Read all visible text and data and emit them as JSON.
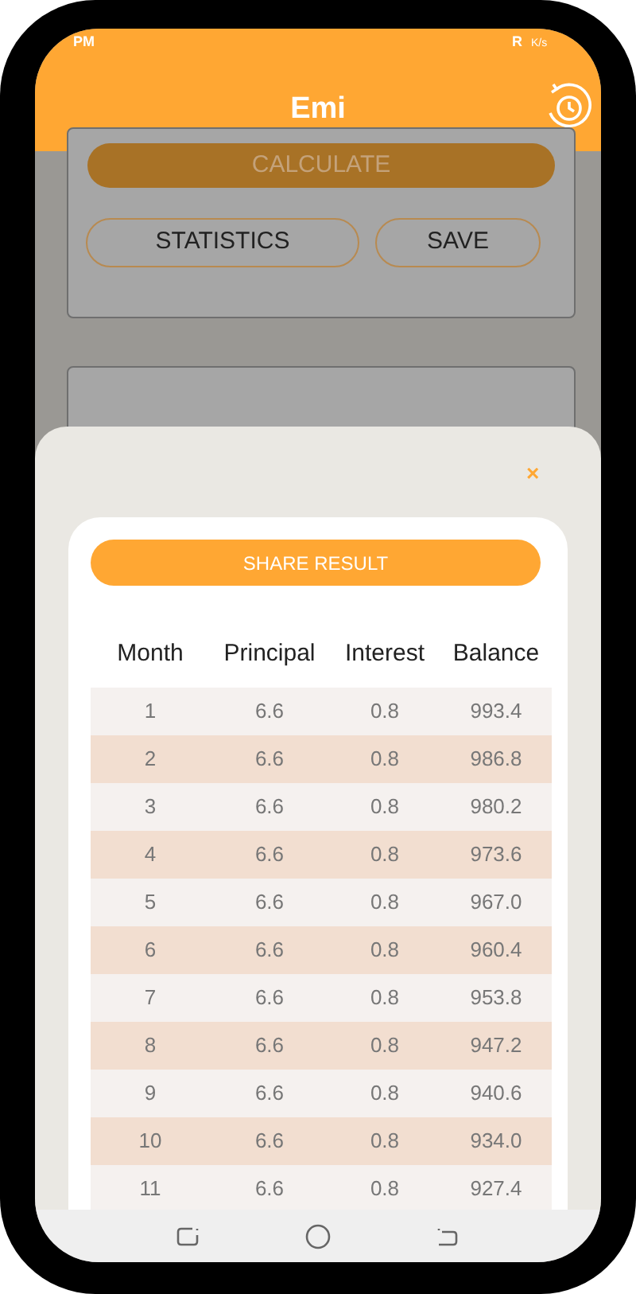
{
  "status_bar": {
    "time": "PM",
    "network": "R",
    "speed": "K/s"
  },
  "app_bar": {
    "title": "Emi"
  },
  "form": {
    "calculate": "CALCULATE",
    "buttons": [
      "STATISTICS",
      "SAVE"
    ]
  },
  "sheet": {
    "close": "×",
    "share": "SHARE RESULT",
    "table": {
      "columns": [
        "Month",
        "Principal",
        "Interest",
        "Balance"
      ],
      "rows": [
        [
          "1",
          "6.6",
          "0.8",
          "993.4"
        ],
        [
          "2",
          "6.6",
          "0.8",
          "986.8"
        ],
        [
          "3",
          "6.6",
          "0.8",
          "980.2"
        ],
        [
          "4",
          "6.6",
          "0.8",
          "973.6"
        ],
        [
          "5",
          "6.6",
          "0.8",
          "967.0"
        ],
        [
          "6",
          "6.6",
          "0.8",
          "960.4"
        ],
        [
          "7",
          "6.6",
          "0.8",
          "953.8"
        ],
        [
          "8",
          "6.6",
          "0.8",
          "947.2"
        ],
        [
          "9",
          "6.6",
          "0.8",
          "940.6"
        ],
        [
          "10",
          "6.6",
          "0.8",
          "934.0"
        ],
        [
          "11",
          "6.6",
          "0.8",
          "927.4"
        ]
      ]
    }
  }
}
